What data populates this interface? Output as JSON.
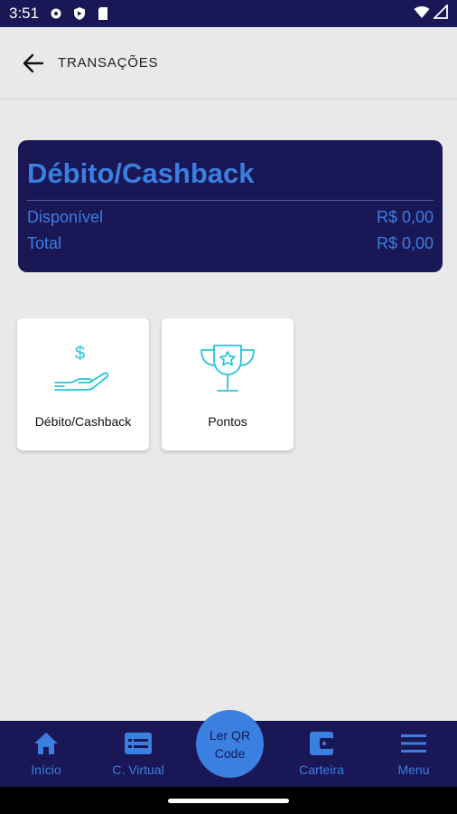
{
  "status_bar": {
    "time": "3:51"
  },
  "app_bar": {
    "title": "TRANSAÇÕES"
  },
  "balance_card": {
    "title": "Débito/Cashback",
    "rows": [
      {
        "label": "Disponível",
        "value": "R$ 0,00"
      },
      {
        "label": "Total",
        "value": "R$ 0,00"
      }
    ]
  },
  "tiles": [
    {
      "label": "Débito/Cashback",
      "icon": "hand-dollar-icon"
    },
    {
      "label": "Pontos",
      "icon": "trophy-icon"
    }
  ],
  "bottom_nav": {
    "items": [
      {
        "label": "Início",
        "icon": "home-icon"
      },
      {
        "label": "C. Virtual",
        "icon": "virtual-card-icon"
      },
      {
        "label": "Carteira",
        "icon": "wallet-icon"
      },
      {
        "label": "Menu",
        "icon": "menu-icon"
      }
    ],
    "qr_button": {
      "line1": "Ler QR",
      "line2": "Code"
    }
  },
  "colors": {
    "navy": "#1a1757",
    "accent": "#3b7fe0",
    "teal_icon": "#27c4d9"
  }
}
